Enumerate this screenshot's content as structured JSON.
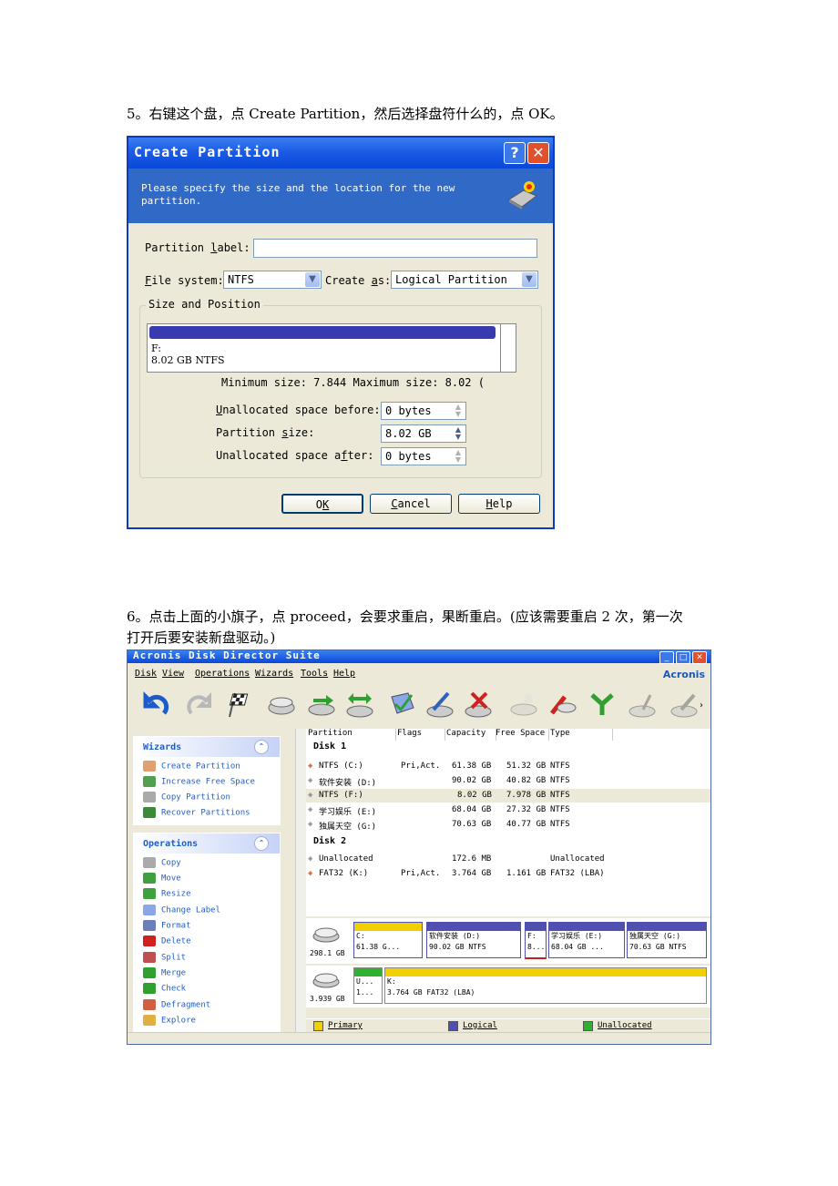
{
  "doc": {
    "step5": "5。右键这个盘，点 Create Partition，然后选择盘符什么的，点 OK。",
    "step6_line1": "6。点击上面的小旗子，点 proceed，会要求重启，果断重启。(应该需要重启 2 次，第一次",
    "step6_line2": "打开后要安装新盘驱动。)"
  },
  "dialog": {
    "title": "Create Partition",
    "help_btn": "?",
    "close_btn": "✕",
    "description": "Please specify the size and the location for the new partition.",
    "label_caption_pre": "Partition ",
    "label_caption_u": "l",
    "label_caption_post": "abel:",
    "label_value": "",
    "fs_caption_u": "F",
    "fs_caption_post": "ile system:",
    "fs_value": "NTFS",
    "create_caption_pre": "Create ",
    "create_caption_u": "a",
    "create_caption_post": "s:",
    "create_value": "Logical Partition",
    "group_title": "Size and Position",
    "slider_line1": "F:",
    "slider_line2": "8.02 GB  NTFS",
    "minmax": "Minimum size: 7.844 Maximum size: 8.02 (",
    "before_caption_u": "U",
    "before_caption_post": "nallocated space before:",
    "before_value": "0 bytes",
    "size_caption_pre": "Partition ",
    "size_caption_u": "s",
    "size_caption_post": "ize:",
    "size_value": "8.02 GB",
    "after_caption_pre": "Unallocated space a",
    "after_caption_u": "f",
    "after_caption_post": "ter:",
    "after_value": "0 bytes",
    "ok_pre": "O",
    "ok_u": "K",
    "cancel_u": "C",
    "cancel_post": "ancel",
    "help_u": "H",
    "help_post": "elp"
  },
  "acronis": {
    "title": "Acronis Disk Director Suite",
    "logo": "Acronis",
    "menu": [
      "Disk",
      "View",
      "Operations",
      "Wizards",
      "Tools",
      "Help"
    ],
    "wizards_title": "Wizards",
    "wizards": [
      "Create Partition",
      "Increase Free Space",
      "Copy Partition",
      "Recover Partitions"
    ],
    "operations_title": "Operations",
    "operations": [
      "Copy",
      "Move",
      "Resize",
      "Change Label",
      "Format",
      "Delete",
      "Split",
      "Merge",
      "Check",
      "Defragment",
      "Explore"
    ],
    "columns": [
      "Partition",
      "Flags",
      "Capacity",
      "Free Space",
      "Type"
    ],
    "disk1": "Disk 1",
    "disk1_rows": [
      {
        "name": "NTFS (C:)",
        "flags": "Pri,Act.",
        "cap": "61.38 GB",
        "free": "51.32 GB",
        "type": "NTFS"
      },
      {
        "name": "软件安装 (D:)",
        "flags": "",
        "cap": "90.02 GB",
        "free": "40.82 GB",
        "type": "NTFS"
      },
      {
        "name": "NTFS (F:)",
        "flags": "",
        "cap": "8.02 GB",
        "free": "7.978 GB",
        "type": "NTFS"
      },
      {
        "name": "学习娱乐 (E:)",
        "flags": "",
        "cap": "68.04 GB",
        "free": "27.32 GB",
        "type": "NTFS"
      },
      {
        "name": "独属天空 (G:)",
        "flags": "",
        "cap": "70.63 GB",
        "free": "40.77 GB",
        "type": "NTFS"
      }
    ],
    "disk2": "Disk 2",
    "disk2_rows": [
      {
        "name": "Unallocated",
        "flags": "",
        "cap": "172.6 MB",
        "free": "",
        "type": "Unallocated"
      },
      {
        "name": "FAT32 (K:)",
        "flags": "Pri,Act.",
        "cap": "3.764 GB",
        "free": "1.161 GB",
        "type": "FAT32 (LBA)"
      }
    ],
    "map1_size": "298.1 GB",
    "map1": [
      {
        "l1": "C:",
        "l2": "61.38 G..."
      },
      {
        "l1": "软件安装 (D:)",
        "l2": "90.02 GB  NTFS"
      },
      {
        "l1": "F:",
        "l2": "8..."
      },
      {
        "l1": "学习娱乐 (E:)",
        "l2": "68.04 GB  ..."
      },
      {
        "l1": "独属天空 (G:)",
        "l2": "70.63 GB  NTFS"
      }
    ],
    "map2_size": "3.939 GB",
    "map2": [
      {
        "l1": "U...",
        "l2": "1..."
      },
      {
        "l1": "K:",
        "l2": "3.764 GB  FAT32 (LBA)"
      }
    ],
    "legend": [
      "Primary",
      "Logical",
      "Unallocated"
    ],
    "colors": {
      "primary": "#f0d000",
      "logical": "#5050b0",
      "unallocated": "#30b030"
    }
  }
}
